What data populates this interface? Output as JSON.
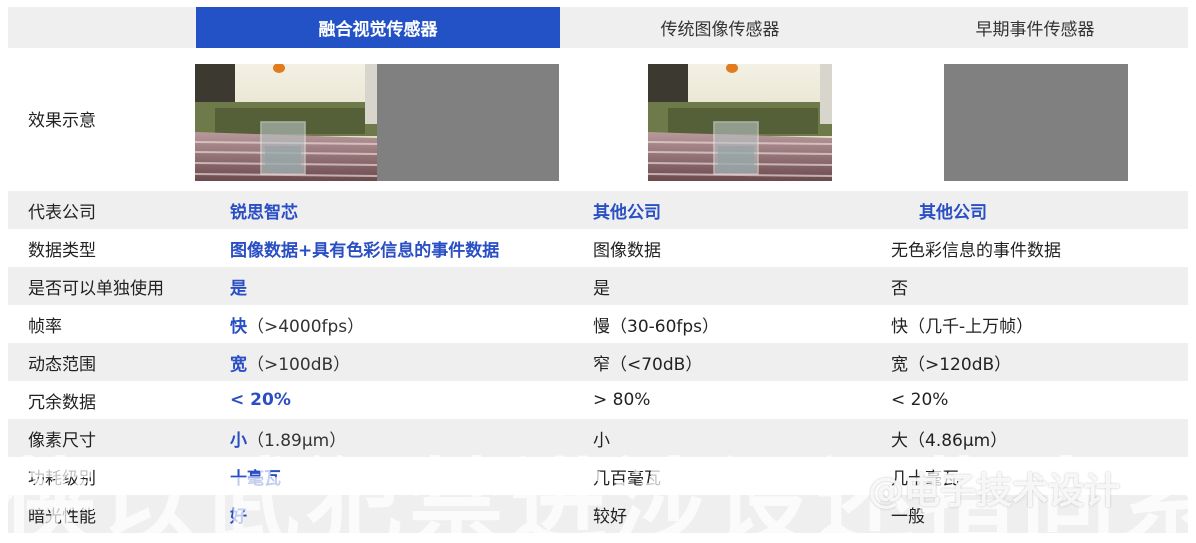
{
  "header": {
    "col1": "融合视觉传感器",
    "col2": "传统图像传感器",
    "col3": "早期事件传感器"
  },
  "effect_row": {
    "label": "效果示意"
  },
  "rows": [
    {
      "label": "代表公司",
      "c1": "锐思智芯",
      "c1_sub": "",
      "c2": "其他公司",
      "c3": "其他公司"
    },
    {
      "label": "数据类型",
      "c1": "图像数据+具有色彩信息的事件数据",
      "c1_sub": "",
      "c2": "图像数据",
      "c3": "无色彩信息的事件数据"
    },
    {
      "label": "是否可以单独使用",
      "c1": "是",
      "c1_sub": "",
      "c2": "是",
      "c3": "否"
    },
    {
      "label": "帧率",
      "c1": "快",
      "c1_sub": "（>4000fps）",
      "c2": "慢（30-60fps）",
      "c3": "快（几千-上万帧）"
    },
    {
      "label": "动态范围",
      "c1": "宽",
      "c1_sub": "（>100dB）",
      "c2": "窄（<70dB）",
      "c3": "宽（>120dB）"
    },
    {
      "label": "冗余数据",
      "c1": "< 20%",
      "c1_sub": "",
      "c2": "> 80%",
      "c3": "< 20%"
    },
    {
      "label": "像素尺寸",
      "c1": "小",
      "c1_sub": "（1.89μm）",
      "c2": "小",
      "c3": "大（4.86μm）"
    },
    {
      "label": "功耗级别",
      "c1": "十毫瓦",
      "c1_sub": "",
      "c2": "几百毫瓦",
      "c3": "几十毫瓦"
    },
    {
      "label": "暗光性能",
      "c1": "好",
      "c1_sub": "",
      "c2": "较好",
      "c3": "一般"
    }
  ],
  "watermark": {
    "logo": "@电子技术设计"
  },
  "colors": {
    "accent": "#2352c7",
    "highlight_text": "#2a4fc4",
    "row_shade": "#efefef"
  }
}
